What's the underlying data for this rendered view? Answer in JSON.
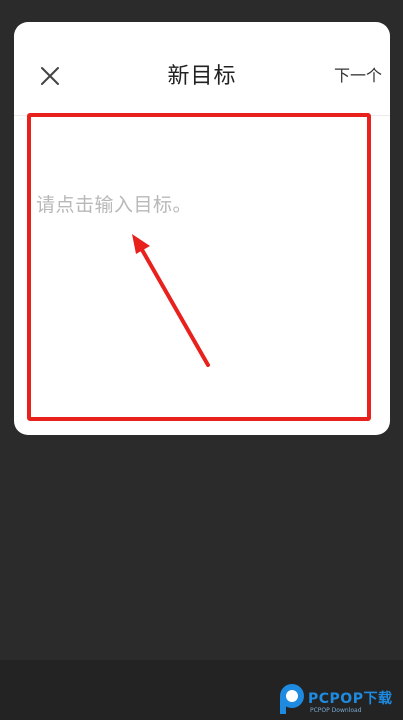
{
  "modal": {
    "title": "新目标",
    "next_label": "下一个",
    "close_icon": "close-icon",
    "input_placeholder": "请点击输入目标。",
    "input_value": ""
  },
  "annotation": {
    "highlight_color": "#e8211d",
    "arrow_color": "#e8211d"
  },
  "watermark": {
    "brand": "PCPOP下载",
    "subtext": "PCPOP Download"
  },
  "colors": {
    "background": "#2b2b2c",
    "bottom_bar": "#232324",
    "modal_bg": "#ffffff",
    "placeholder": "#b8b8b8"
  }
}
